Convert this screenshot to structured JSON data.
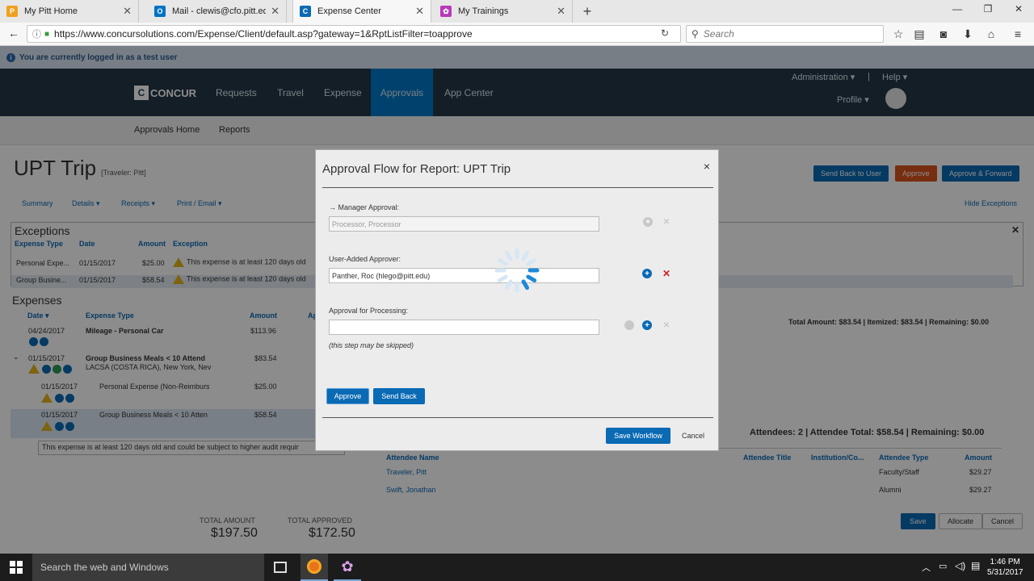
{
  "browser": {
    "tabs": [
      {
        "label": "My Pitt Home",
        "color": "#f0a020",
        "icon": "P",
        "active": false
      },
      {
        "label": "Mail - clewis@cfo.pitt.edu",
        "color": "#0072c6",
        "icon": "O",
        "active": false
      },
      {
        "label": "Expense Center",
        "color": "#0a6ab4",
        "icon": "C",
        "active": true
      },
      {
        "label": "My Trainings",
        "color": "#b83ab8",
        "icon": "✿",
        "active": false
      }
    ],
    "url": "https://www.concursolutions.com/Expense/Client/default.asp?gateway=1&RptListFilter=toapprove",
    "search_placeholder": "Search"
  },
  "banner": {
    "text": "You are currently logged in as a test user"
  },
  "header": {
    "logo": "CONCUR",
    "nav": [
      "Requests",
      "Travel",
      "Expense",
      "Approvals",
      "App Center"
    ],
    "active_nav": "Approvals",
    "admin": "Administration ▾",
    "help": "Help ▾",
    "profile": "Profile ▾"
  },
  "subnav": {
    "items": [
      "Approvals Home",
      "Reports"
    ]
  },
  "report": {
    "title": "UPT Trip",
    "traveler": "[Traveler: Pitt]",
    "tabs": [
      "Summary",
      "Details ▾",
      "Receipts ▾",
      "Print / Email ▾"
    ],
    "buttons": {
      "send_back": "Send Back to User",
      "approve": "Approve",
      "approve_forward": "Approve & Forward"
    },
    "hide_exceptions": "Hide Exceptions"
  },
  "exceptions": {
    "heading": "Exceptions",
    "columns": [
      "Expense Type",
      "Date",
      "Amount",
      "Exception"
    ],
    "rows": [
      {
        "type": "Personal Expe...",
        "date": "01/15/2017",
        "amount": "$25.00",
        "exception": "This expense is at least 120 days old"
      },
      {
        "type": "Group Busine...",
        "date": "01/15/2017",
        "amount": "$58.54",
        "exception": "This expense is at least 120 days old"
      }
    ]
  },
  "expenses": {
    "heading": "Expenses",
    "columns": [
      "Date ▾",
      "Expense Type",
      "Amount",
      "Ap"
    ],
    "rows": [
      {
        "date": "04/24/2017",
        "type": "Mileage - Personal Car",
        "sub": "",
        "amount": "$113.96"
      },
      {
        "date": "01/15/2017",
        "type": "Group Business Meals < 10 Attend",
        "sub": "LACSA (COSTA RICA), New York, Nev",
        "amount": "$83.54"
      },
      {
        "date": "01/15/2017",
        "type": "Personal Expense (Non-Reimburs",
        "sub": "",
        "amount": "$25.00"
      },
      {
        "date": "01/15/2017",
        "type": "Group Business Meals < 10 Atten",
        "sub": "",
        "amount": "$58.54"
      }
    ],
    "tooltip": "This expense is at least 120 days old and could be subject to higher audit requir",
    "total_amount_label": "TOTAL AMOUNT",
    "total_amount": "$197.50",
    "total_approved_label": "TOTAL APPROVED",
    "total_approved": "$172.50"
  },
  "detail": {
    "summary": "Total Amount: $83.54 | Itemized: $83.54 | Remaining: $0.00",
    "attendees_summary": "Attendees: 2  |  Attendee Total: $58.54  |  Remaining: $0.00",
    "columns": [
      "Attendee Name",
      "Attendee Title",
      "Institution/Co...",
      "Attendee Type",
      "Amount"
    ],
    "rows": [
      {
        "name": "Traveler, Pitt",
        "type": "Faculty/Staff",
        "amount": "$29.27"
      },
      {
        "name": "Swift, Jonathan",
        "type": "Alumni",
        "amount": "$29.27"
      }
    ],
    "buttons": {
      "save": "Save",
      "allocate": "Allocate",
      "cancel": "Cancel"
    }
  },
  "modal": {
    "title": "Approval Flow for Report: UPT Trip",
    "steps": [
      {
        "label": "Manager Approval:",
        "value": "Processor, Processor",
        "disabled": true
      },
      {
        "label": "User-Added Approver:",
        "value": "Panther, Roc (hlego@pitt.edu)",
        "disabled": false
      },
      {
        "label": "Approval for Processing:",
        "value": "",
        "disabled": false
      }
    ],
    "skip_note": "(this step may be skipped)",
    "approve": "Approve",
    "send_back": "Send Back",
    "save_workflow": "Save Workflow",
    "cancel": "Cancel",
    "close_glyph": "×"
  },
  "taskbar": {
    "search": "Search the web and Windows",
    "time": "1:46 PM",
    "date": "5/31/2017"
  },
  "colors": {
    "header_bg": "#243848",
    "accent_blue": "#0078c8",
    "approve_orange": "#d9531e",
    "remove_red": "#cc2222"
  }
}
